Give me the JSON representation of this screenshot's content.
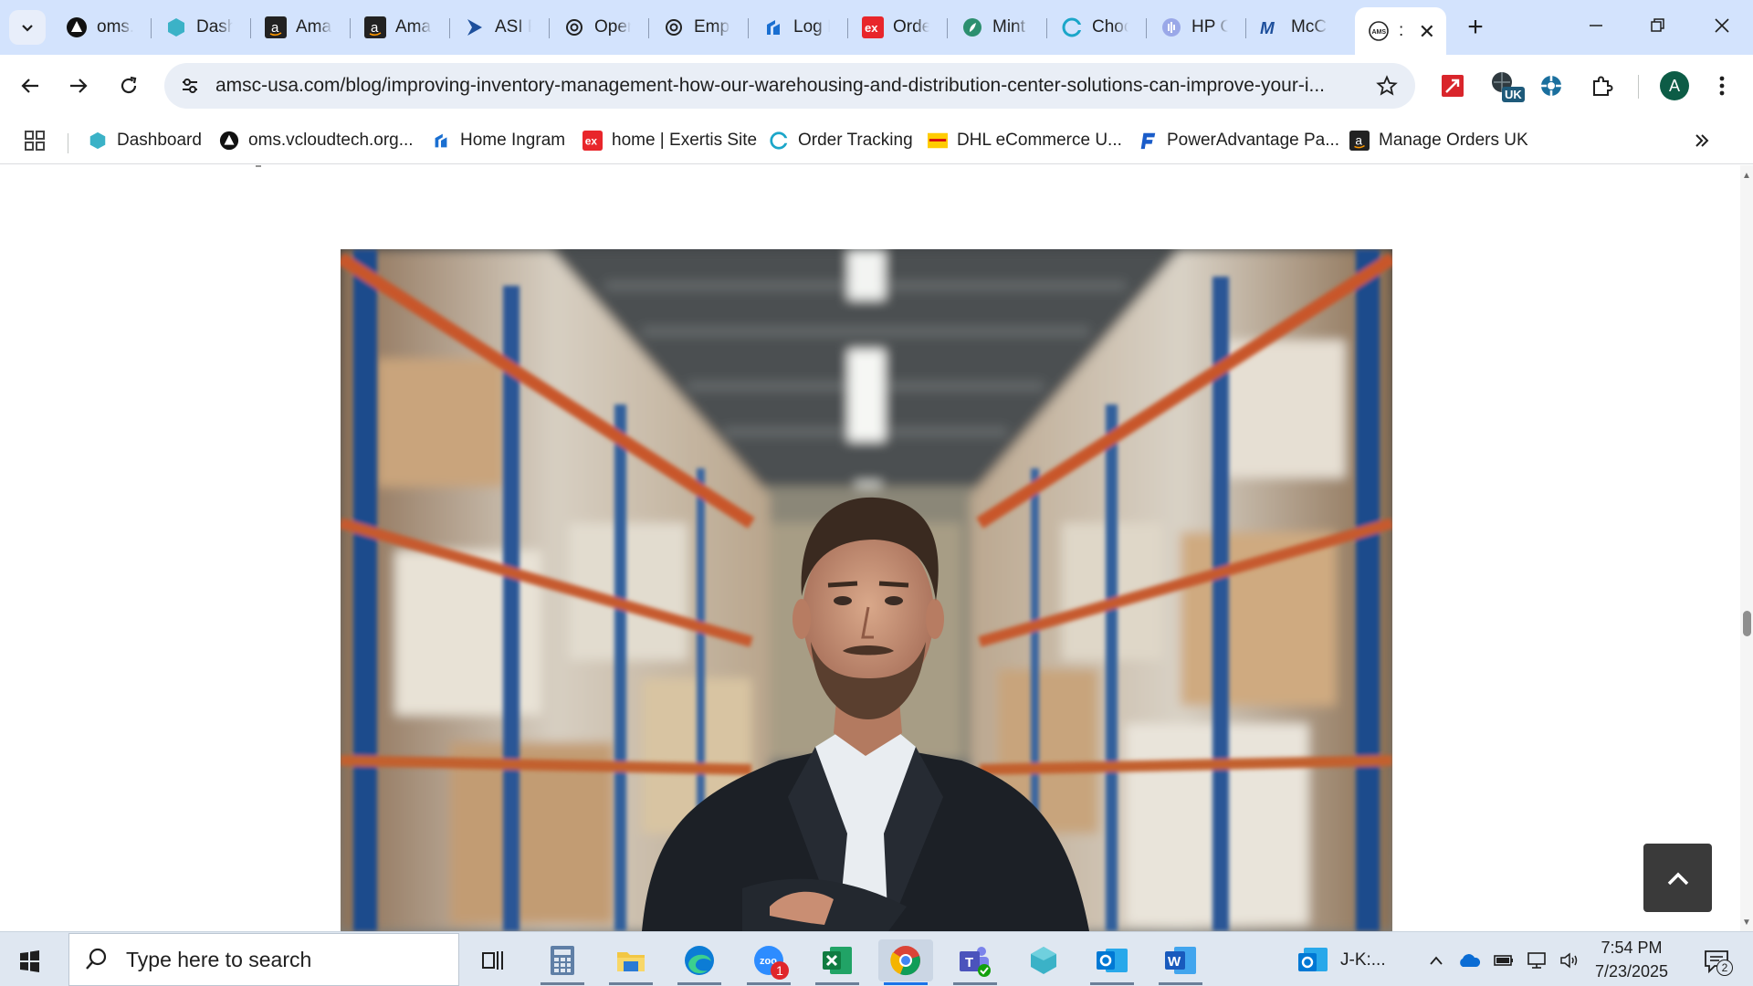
{
  "browser": {
    "tabs": [
      {
        "title": "oms.",
        "icon": "triangle-logo-icon"
      },
      {
        "title": "Dash",
        "icon": "hexagon-logo-icon"
      },
      {
        "title": "Ama",
        "icon": "amazon-icon"
      },
      {
        "title": "Ama",
        "icon": "amazon-icon"
      },
      {
        "title": "ASI F",
        "icon": "arrow-logo-icon"
      },
      {
        "title": "Oper",
        "icon": "openai-icon"
      },
      {
        "title": "Empl",
        "icon": "openai-icon"
      },
      {
        "title": "Log I",
        "icon": "ingram-icon"
      },
      {
        "title": "Orde",
        "icon": "exertis-icon"
      },
      {
        "title": "Mint",
        "icon": "mint-icon"
      },
      {
        "title": "Choc",
        "icon": "c-logo-icon"
      },
      {
        "title": "HP C",
        "icon": "hp-icon"
      },
      {
        "title": "McC",
        "icon": "m-logo-icon"
      },
      {
        "title": ":",
        "icon": "amsc-icon",
        "active": true
      }
    ],
    "url": "amsc-usa.com/blog/improving-inventory-management-how-our-warehousing-and-distribution-center-solutions-can-improve-your-i...",
    "profile_initial": "A",
    "extension_badge": "UK",
    "bookmarks": [
      {
        "label": "Dashboard",
        "icon": "hexagon-logo-icon"
      },
      {
        "label": "oms.vcloudtech.org...",
        "icon": "triangle-logo-icon"
      },
      {
        "label": "Home Ingram",
        "icon": "ingram-icon"
      },
      {
        "label": "home | Exertis Site",
        "icon": "exertis-icon"
      },
      {
        "label": "Order Tracking",
        "icon": "c-logo-icon"
      },
      {
        "label": "DHL eCommerce U...",
        "icon": "dhl-icon"
      },
      {
        "label": "PowerAdvantage Pa...",
        "icon": "f-logo-icon"
      },
      {
        "label": "Manage Orders UK",
        "icon": "amazon-icon"
      }
    ]
  },
  "taskbar": {
    "search_placeholder": "Type here to search",
    "zoom_badge": "1",
    "pinned_label": "J-K:...",
    "time": "7:54 PM",
    "date": "7/23/2025",
    "notification_count": "2"
  },
  "colors": {
    "tabstrip": "#d3e3fd",
    "omnibox": "#e9eef6",
    "taskbar": "#dfe7f1",
    "back_to_top": "#3a3a3a"
  }
}
